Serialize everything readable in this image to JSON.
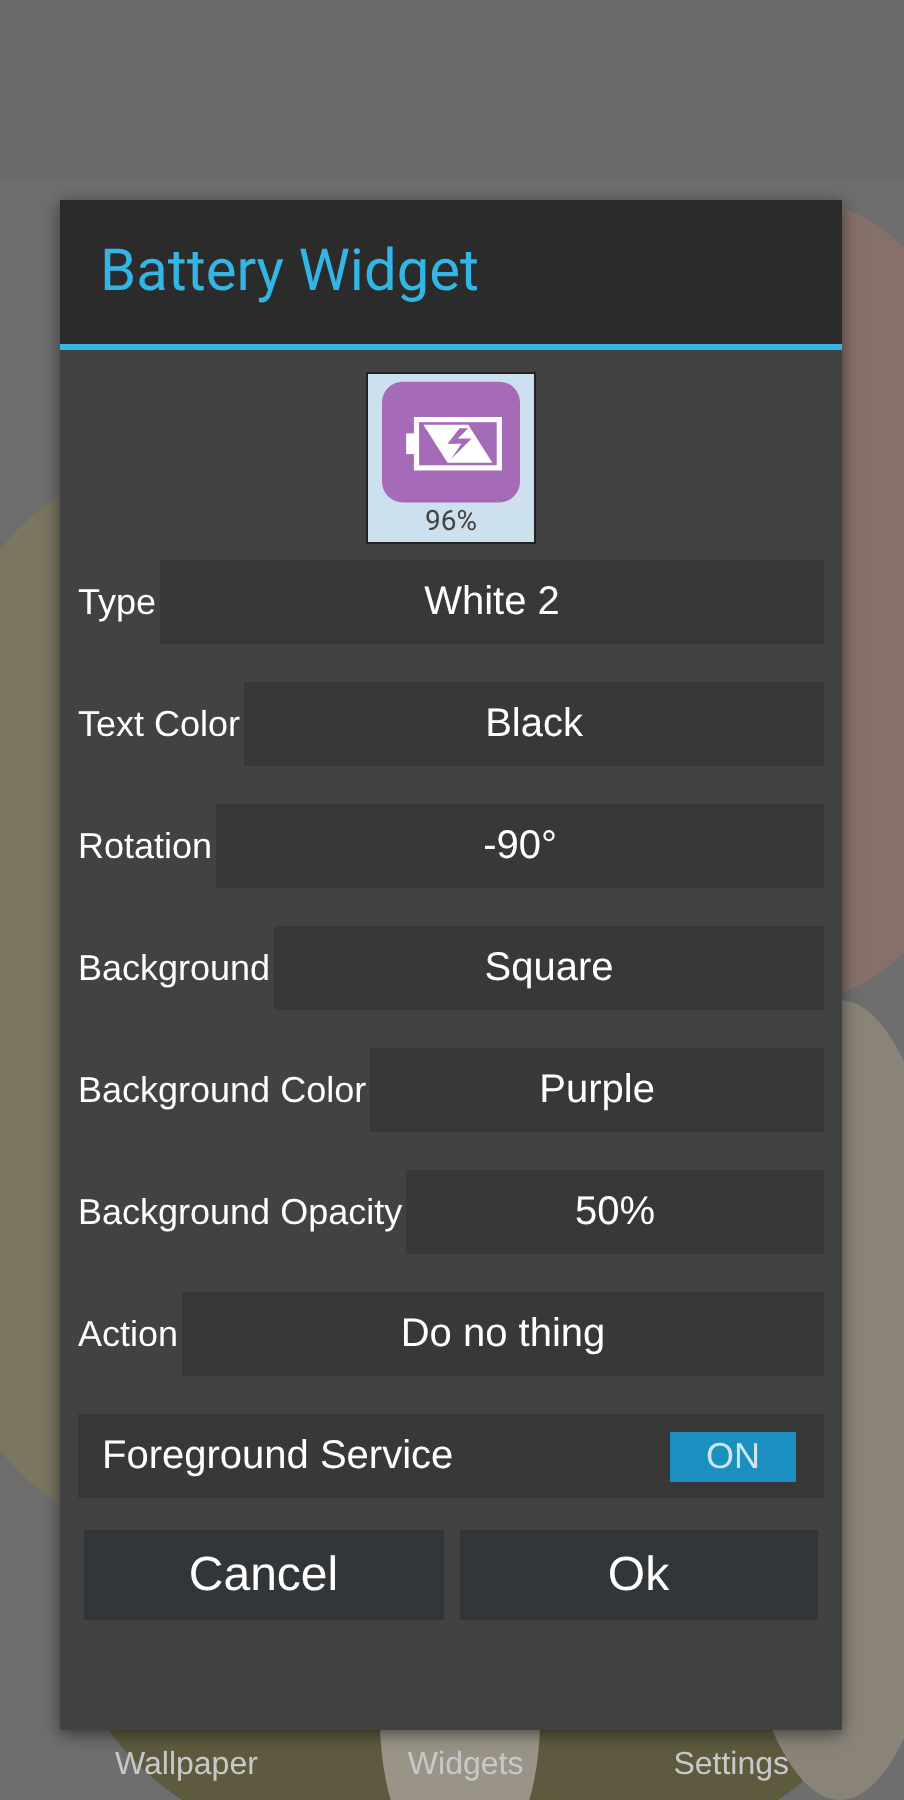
{
  "dialog": {
    "title": "Battery Widget",
    "preview": {
      "percent": "96%"
    },
    "settings": [
      {
        "label": "Type",
        "value": "White 2"
      },
      {
        "label": "Text Color",
        "value": "Black"
      },
      {
        "label": "Rotation",
        "value": "-90°"
      },
      {
        "label": "Background",
        "value": "Square"
      },
      {
        "label": "Background Color",
        "value": "Purple"
      },
      {
        "label": "Background Opacity",
        "value": "50%"
      },
      {
        "label": "Action",
        "value": "Do no thing"
      }
    ],
    "foreground_service": {
      "label": "Foreground Service",
      "on": true,
      "toggle_text": "ON"
    },
    "buttons": [
      "Cancel",
      "Ok"
    ]
  },
  "bottom_nav": [
    "Wallpaper",
    "Widgets",
    "Settings"
  ]
}
